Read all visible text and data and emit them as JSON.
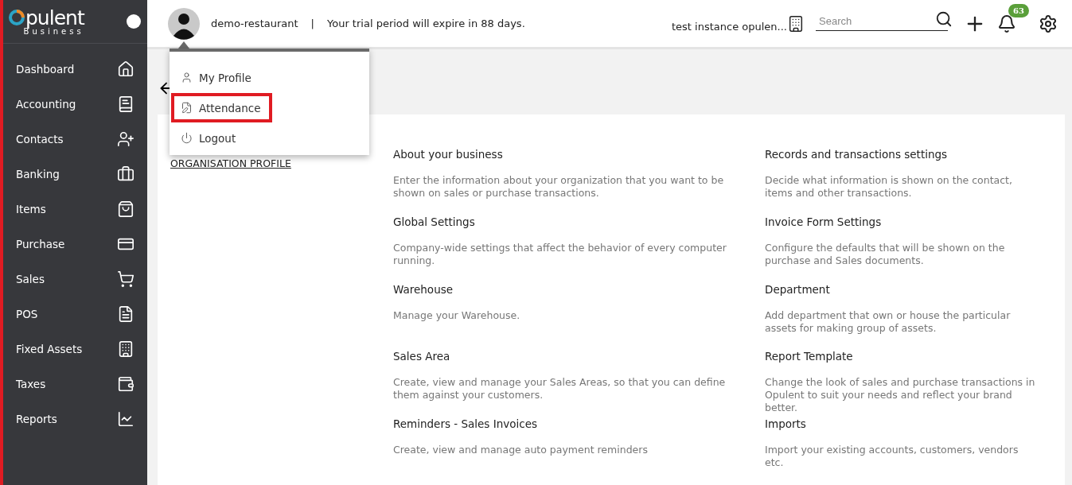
{
  "logo": {
    "wordmark": "pulent",
    "tagline": "Business"
  },
  "sidebar": {
    "items": [
      {
        "label": "Dashboard",
        "selected": false
      },
      {
        "label": "Accounting",
        "selected": false
      },
      {
        "label": "Contacts",
        "selected": false
      },
      {
        "label": "Banking",
        "selected": false
      },
      {
        "label": "Items",
        "selected": false
      },
      {
        "label": "Purchase",
        "selected": false
      },
      {
        "label": "Sales",
        "selected": false
      },
      {
        "label": "POS",
        "selected": false
      },
      {
        "label": "Fixed Assets",
        "selected": false
      },
      {
        "label": "Taxes",
        "selected": false
      },
      {
        "label": "Reports",
        "selected": false
      }
    ]
  },
  "header": {
    "organisation": "demo-restaurant",
    "separator": "|",
    "trial_notice": "Your trial period will expire in 88 days.",
    "instance": "test instance opulen...",
    "search": {
      "placeholder": "Search"
    },
    "notification_count": "63"
  },
  "user_menu": {
    "items": [
      {
        "label": "My Profile",
        "highlighted": false
      },
      {
        "label": "Attendance",
        "highlighted": true
      },
      {
        "label": "Logout",
        "highlighted": false
      }
    ]
  },
  "settings": {
    "section_title": "ORGANISATION PROFILE",
    "cards": [
      {
        "title": "About your business",
        "description": "Enter the information about your organization that you want to be shown on sales or purchase transactions."
      },
      {
        "title": "Records and transactions settings",
        "description": "Decide what information is shown on the contact, items and other transactions."
      },
      {
        "title": "Global Settings",
        "description": "Company-wide settings that affect the behavior of every computer running."
      },
      {
        "title": "Invoice Form Settings",
        "description": "Configure the defaults that will be shown on the purchase and Sales documents."
      },
      {
        "title": "Warehouse",
        "description": "Manage your Warehouse."
      },
      {
        "title": "Department",
        "description": "Add department that own or house the particular assets for making group of assets."
      },
      {
        "title": "Sales Area",
        "description": "Create, view and manage your Sales Areas, so that you can define them against your customers."
      },
      {
        "title": "Report Template",
        "description": "Change the look of sales and purchase transactions in Opulent to suit your needs and reflect your brand better."
      },
      {
        "title": "Reminders - Sales Invoices",
        "description": "Create, view and manage auto payment reminders"
      },
      {
        "title": "Imports",
        "description": "Import your existing accounts, customers, vendors etc."
      }
    ]
  }
}
